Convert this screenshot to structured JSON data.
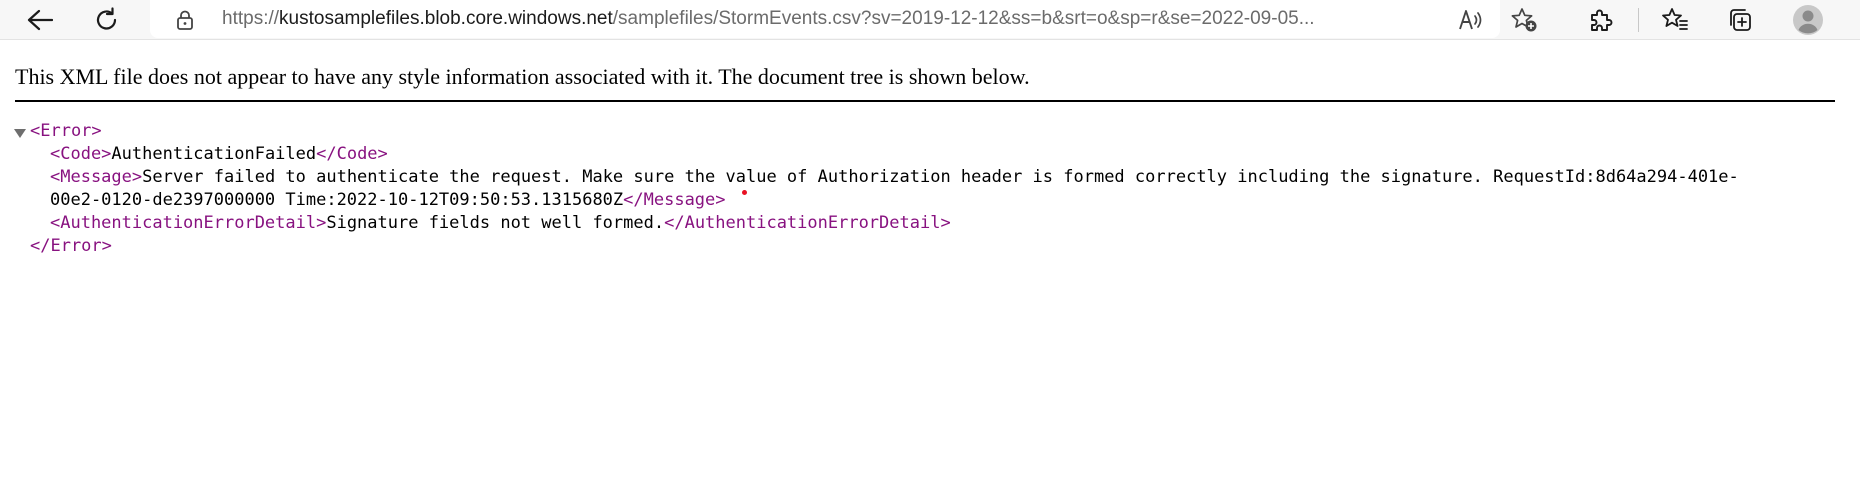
{
  "browser": {
    "icons": {
      "back": "back-arrow-icon",
      "refresh": "refresh-icon",
      "lock": "lock-icon",
      "read_aloud": "read-aloud-icon",
      "add_favorite": "add-favorite-icon",
      "extensions": "extensions-puzzle-icon",
      "favorites": "favorites-star-icon",
      "collections": "collections-icon",
      "profile": "profile-avatar-icon"
    },
    "url_prefix": "https://",
    "url_host": "kustosamplefiles.blob.core.windows.net",
    "url_rest": "/samplefiles/StormEvents.csv?sv=2019-12-12&ss=b&srt=o&sp=r&se=2022-09-05..."
  },
  "page": {
    "notice": "This XML file does not appear to have any style information associated with it. The document tree is shown below.",
    "xml": {
      "error_open": "<Error>",
      "code_open": "<Code>",
      "code_value": "AuthenticationFailed",
      "code_close": "</Code>",
      "message_open": "<Message>",
      "message_value_line1": "Server failed to authenticate the request. Make sure the value of Authorization header is formed correctly including the signature. RequestId:8d64a294-401e-",
      "message_value_line2": "00e2-0120-de2397000000 Time:2022-10-12T09:50:53.1315680Z",
      "message_close": "</Message>",
      "detail_open": "<AuthenticationErrorDetail>",
      "detail_value": "Signature fields not well formed.",
      "detail_close": "</AuthenticationErrorDetail>",
      "error_close": "</Error>"
    }
  },
  "colors": {
    "tag": "#881280",
    "toolbar_bg": "#f7f7f7"
  }
}
